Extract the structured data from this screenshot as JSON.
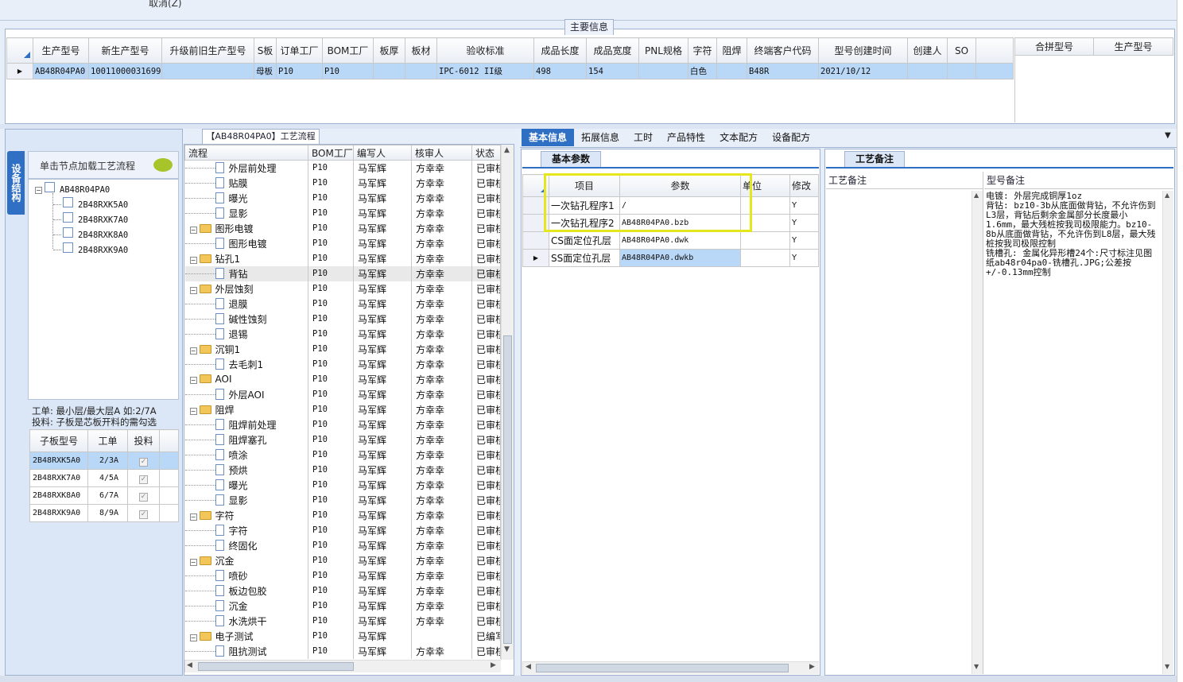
{
  "top": {
    "cancel_label": "取消(Z)"
  },
  "main_info": {
    "title": "主要信息",
    "columns": [
      "生产型号",
      "新生产型号",
      "升级前旧生产型号",
      "S板",
      "订单工厂",
      "BOM工厂",
      "板厚",
      "板材",
      "验收标准",
      "成品长度",
      "成品宽度",
      "PNL规格",
      "字符",
      "阻焊",
      "终端客户代码",
      "型号创建时间",
      "创建人",
      "SO"
    ],
    "row": [
      "AB48R04PA0",
      "10011000031699",
      "",
      "母板",
      "P10",
      "P10",
      "",
      "",
      "IPC-6012 II级",
      "498",
      "154",
      "",
      "白色",
      "",
      "B48R",
      "2021/10/12",
      "",
      ""
    ],
    "right_columns": [
      "合拼型号",
      "生产型号"
    ]
  },
  "vertical_tab": {
    "label": "设备结构"
  },
  "tree": {
    "hint": "单击节点加载工艺流程",
    "root": "AB48R04PA0",
    "children": [
      "2B48RXK5A0",
      "2B48RXK7A0",
      "2B48RXK8A0",
      "2B48RXK9A0"
    ]
  },
  "note": {
    "line1": "工单: 最小层/最大层A 如:2/7A",
    "line2": "投料: 子板是芯板开料的需勾选"
  },
  "sub_table": {
    "columns": [
      "子板型号",
      "工单",
      "投料"
    ],
    "rows": [
      [
        "2B48RXK5A0",
        "2/3A"
      ],
      [
        "2B48RXK7A0",
        "4/5A"
      ],
      [
        "2B48RXK8A0",
        "6/7A"
      ],
      [
        "2B48RXK9A0",
        "8/9A"
      ]
    ]
  },
  "process": {
    "title": "【AB48R04PA0】工艺流程",
    "columns": [
      "流程",
      "BOM工厂",
      "编写人",
      "核审人",
      "状态"
    ],
    "rows": [
      {
        "level": 2,
        "name": "外层前处理",
        "bom": "P10",
        "author": "马军辉",
        "reviewer": "方幸幸",
        "status": "已审核"
      },
      {
        "level": 2,
        "name": "贴膜",
        "bom": "P10",
        "author": "马军辉",
        "reviewer": "方幸幸",
        "status": "已审核"
      },
      {
        "level": 2,
        "name": "曝光",
        "bom": "P10",
        "author": "马军辉",
        "reviewer": "方幸幸",
        "status": "已审核"
      },
      {
        "level": 2,
        "name": "显影",
        "bom": "P10",
        "author": "马军辉",
        "reviewer": "方幸幸",
        "status": "已审核"
      },
      {
        "level": 1,
        "name": "图形电镀",
        "bom": "P10",
        "author": "马军辉",
        "reviewer": "方幸幸",
        "status": "已审核"
      },
      {
        "level": 2,
        "name": "图形电镀",
        "bom": "P10",
        "author": "马军辉",
        "reviewer": "方幸幸",
        "status": "已审核"
      },
      {
        "level": 1,
        "name": "钻孔1",
        "bom": "P10",
        "author": "马军辉",
        "reviewer": "方幸幸",
        "status": "已审核"
      },
      {
        "level": 2,
        "name": "背钻",
        "bom": "P10",
        "author": "马军辉",
        "reviewer": "方幸幸",
        "status": "已审核",
        "selected": true
      },
      {
        "level": 1,
        "name": "外层蚀刻",
        "bom": "P10",
        "author": "马军辉",
        "reviewer": "方幸幸",
        "status": "已审核"
      },
      {
        "level": 2,
        "name": "退膜",
        "bom": "P10",
        "author": "马军辉",
        "reviewer": "方幸幸",
        "status": "已审核"
      },
      {
        "level": 2,
        "name": "碱性蚀刻",
        "bom": "P10",
        "author": "马军辉",
        "reviewer": "方幸幸",
        "status": "已审核"
      },
      {
        "level": 2,
        "name": "退锡",
        "bom": "P10",
        "author": "马军辉",
        "reviewer": "方幸幸",
        "status": "已审核"
      },
      {
        "level": 1,
        "name": "沉铜1",
        "bom": "P10",
        "author": "马军辉",
        "reviewer": "方幸幸",
        "status": "已审核"
      },
      {
        "level": 2,
        "name": "去毛刺1",
        "bom": "P10",
        "author": "马军辉",
        "reviewer": "方幸幸",
        "status": "已审核"
      },
      {
        "level": 1,
        "name": "AOI",
        "bom": "P10",
        "author": "马军辉",
        "reviewer": "方幸幸",
        "status": "已审核"
      },
      {
        "level": 2,
        "name": "外层AOI",
        "bom": "P10",
        "author": "马军辉",
        "reviewer": "方幸幸",
        "status": "已审核"
      },
      {
        "level": 1,
        "name": "阻焊",
        "bom": "P10",
        "author": "马军辉",
        "reviewer": "方幸幸",
        "status": "已审核"
      },
      {
        "level": 2,
        "name": "阻焊前处理",
        "bom": "P10",
        "author": "马军辉",
        "reviewer": "方幸幸",
        "status": "已审核"
      },
      {
        "level": 2,
        "name": "阻焊塞孔",
        "bom": "P10",
        "author": "马军辉",
        "reviewer": "方幸幸",
        "status": "已审核"
      },
      {
        "level": 2,
        "name": "喷涂",
        "bom": "P10",
        "author": "马军辉",
        "reviewer": "方幸幸",
        "status": "已审核"
      },
      {
        "level": 2,
        "name": "预烘",
        "bom": "P10",
        "author": "马军辉",
        "reviewer": "方幸幸",
        "status": "已审核"
      },
      {
        "level": 2,
        "name": "曝光",
        "bom": "P10",
        "author": "马军辉",
        "reviewer": "方幸幸",
        "status": "已审核"
      },
      {
        "level": 2,
        "name": "显影",
        "bom": "P10",
        "author": "马军辉",
        "reviewer": "方幸幸",
        "status": "已审核"
      },
      {
        "level": 1,
        "name": "字符",
        "bom": "P10",
        "author": "马军辉",
        "reviewer": "方幸幸",
        "status": "已审核"
      },
      {
        "level": 2,
        "name": "字符",
        "bom": "P10",
        "author": "马军辉",
        "reviewer": "方幸幸",
        "status": "已审核"
      },
      {
        "level": 2,
        "name": "终固化",
        "bom": "P10",
        "author": "马军辉",
        "reviewer": "方幸幸",
        "status": "已审核"
      },
      {
        "level": 1,
        "name": "沉金",
        "bom": "P10",
        "author": "马军辉",
        "reviewer": "方幸幸",
        "status": "已审核"
      },
      {
        "level": 2,
        "name": "喷砂",
        "bom": "P10",
        "author": "马军辉",
        "reviewer": "方幸幸",
        "status": "已审核"
      },
      {
        "level": 2,
        "name": "板边包胶",
        "bom": "P10",
        "author": "马军辉",
        "reviewer": "方幸幸",
        "status": "已审核"
      },
      {
        "level": 2,
        "name": "沉金",
        "bom": "P10",
        "author": "马军辉",
        "reviewer": "方幸幸",
        "status": "已审核"
      },
      {
        "level": 2,
        "name": "水洗烘干",
        "bom": "P10",
        "author": "马军辉",
        "reviewer": "方幸幸",
        "status": "已审核"
      },
      {
        "level": 1,
        "name": "电子测试",
        "bom": "P10",
        "author": "马军辉",
        "reviewer": "",
        "status": "已编写"
      },
      {
        "level": 2,
        "name": "阻抗测试",
        "bom": "P10",
        "author": "马军辉",
        "reviewer": "方幸幸",
        "status": "已审核"
      }
    ]
  },
  "right_tabs": [
    "基本信息",
    "拓展信息",
    "工时",
    "产品特性",
    "文本配方",
    "设备配方"
  ],
  "basic_params": {
    "title": "基本参数",
    "columns": [
      "项目",
      "参数",
      "单位",
      "修改"
    ],
    "rows": [
      [
        "一次钻孔程序1",
        "/",
        "",
        "Y"
      ],
      [
        "一次钻孔程序2",
        "AB48R04PA0.bzb",
        "",
        "Y"
      ],
      [
        "CS面定位孔层",
        "AB48R04PA0.dwk",
        "",
        "Y"
      ],
      [
        "SS面定位孔层",
        "AB48R04PA0.dwkb",
        "",
        "Y"
      ]
    ]
  },
  "remarks": {
    "title": "工艺备注",
    "col1": "工艺备注",
    "col2": "型号备注",
    "text": "电镀: 外层完成铜厚1oz\n背钻: bz10-3b从底面做背钻，不允许伤到L3层，背钻后剩余金属部分长度最小1.6mm，最大残桩按我司极限能力。bz10-8b从底面做背钻，不允许伤到L8层，最大残桩按我司极限控制\n铣槽孔: 金属化异形槽24个:尺寸标注见图纸ab48r04pa0-铣槽孔.JPG;公差按+/-0.13mm控制"
  },
  "colors": {
    "accent": "#2f6fc4",
    "selection": "#b9d7f7",
    "highlight": "#e6e61e"
  }
}
